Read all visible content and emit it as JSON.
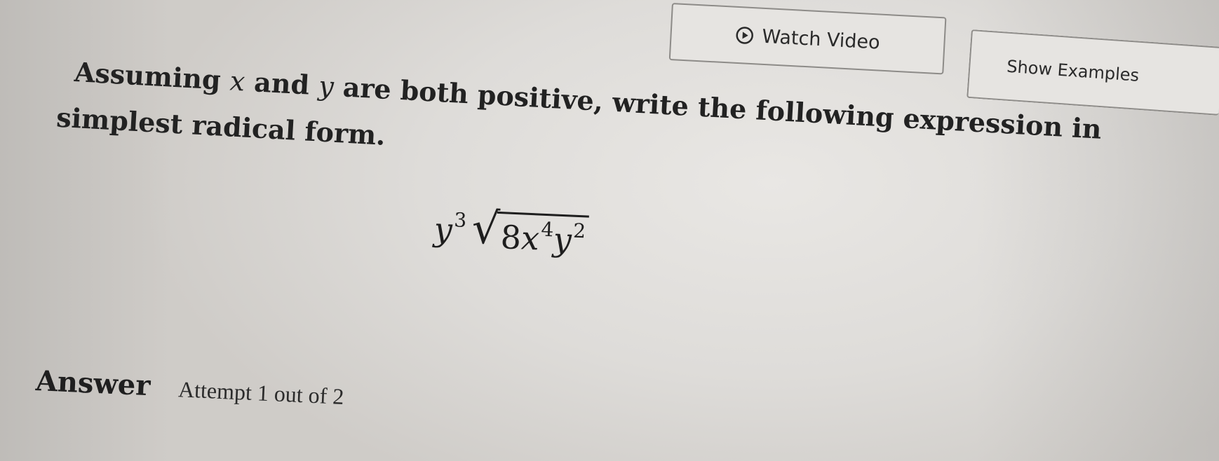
{
  "header": {
    "watch_video_label": "Watch Video",
    "show_examples_label": "Show Examples",
    "watch_video_icon": "play-circle-icon"
  },
  "question": {
    "line1_pre": "Assuming ",
    "var_x": "x",
    "line1_mid": " and ",
    "var_y": "y",
    "line1_post": " are both positive, write the following expression in",
    "line2": "simplest radical form."
  },
  "expression": {
    "base": "y",
    "base_exponent": "3",
    "radicand_coefficient": "8",
    "radicand_x": "x",
    "radicand_x_exponent": "4",
    "radicand_y": "y",
    "radicand_y_exponent": "2"
  },
  "answer": {
    "label": "Answer",
    "attempt_text": "Attempt 1 out of 2"
  },
  "colors": {
    "background": "#dedcd9",
    "text": "#1f1f1f",
    "button_border": "#8d8b88"
  }
}
